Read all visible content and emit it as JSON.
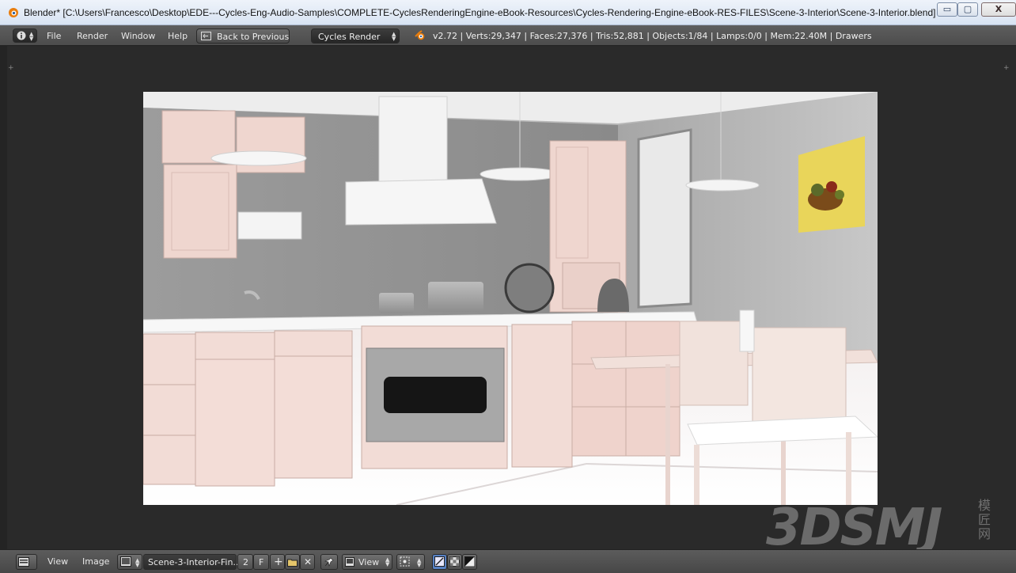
{
  "window": {
    "title": "Blender* [C:\\Users\\Francesco\\Desktop\\EDE---Cycles-Eng-Audio-Samples\\COMPLETE-CyclesRenderingEngine-eBook-Resources\\Cycles-Rendering-Engine-eBook-RES-FILES\\Scene-3-Interior\\Scene-3-Interior.blend]",
    "minimize_icon": "minimize-icon",
    "maximize_icon": "maximize-icon",
    "close_icon": "close-icon",
    "minimize_glyph": "▭",
    "maximize_glyph": "▢",
    "close_glyph": "X"
  },
  "info_header": {
    "menu": [
      "File",
      "Render",
      "Window",
      "Help"
    ],
    "back_button": "Back to Previous",
    "render_engine": "Cycles Render",
    "stats": "v2.72 | Verts:29,347 | Faces:27,376 | Tris:52,881 | Objects:1/84 | Lamps:0/0 | Mem:22.40M | Drawers"
  },
  "image_header": {
    "menu": [
      "View",
      "Image"
    ],
    "image_name": "Scene-3-Interior-Fin...",
    "users_count": "2",
    "fake_user": "F",
    "view_mode": "View"
  },
  "watermark": {
    "text": "3DSMJ",
    "cn_text": "模匠网"
  },
  "colors": {
    "accent": "#e87d0d",
    "header_bg": "#555555",
    "editor_bg": "#2a2a2a",
    "active_toggle": "#5680c2"
  }
}
